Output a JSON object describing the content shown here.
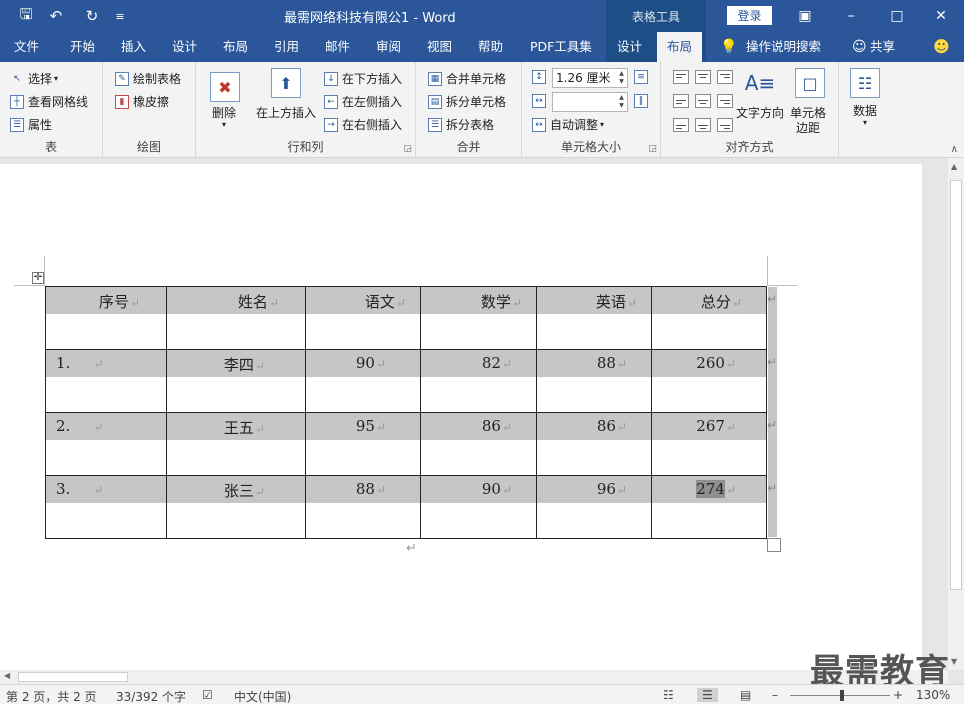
{
  "titlebar": {
    "doc_title": "最需网络科技有限公1  -  Word",
    "context_label": "表格工具",
    "login_label": "登录"
  },
  "tabs": [
    {
      "label": "文件"
    },
    {
      "label": "开始"
    },
    {
      "label": "插入"
    },
    {
      "label": "设计"
    },
    {
      "label": "布局"
    },
    {
      "label": "引用"
    },
    {
      "label": "邮件"
    },
    {
      "label": "审阅"
    },
    {
      "label": "视图"
    },
    {
      "label": "帮助"
    },
    {
      "label": "PDF工具集"
    },
    {
      "label": "设计"
    },
    {
      "label": "布局"
    }
  ],
  "search_label": "操作说明搜索",
  "share_label": "共享",
  "ribbon": {
    "table_group": {
      "label": "表",
      "select": "选择",
      "gridlines": "查看网格线",
      "properties": "属性"
    },
    "draw_group": {
      "label": "绘图",
      "draw_table": "绘制表格",
      "eraser": "橡皮擦"
    },
    "rows_group": {
      "label": "行和列",
      "delete": "删除",
      "insert_above": "在上方插入",
      "insert_below": "在下方插入",
      "insert_left": "在左侧插入",
      "insert_right": "在右侧插入"
    },
    "merge_group": {
      "label": "合并",
      "merge": "合并单元格",
      "split_cells": "拆分单元格",
      "split_table": "拆分表格"
    },
    "cellsize_group": {
      "label": "单元格大小",
      "height_value": "1.26 厘米",
      "autofit": "自动调整"
    },
    "align_group": {
      "label": "对齐方式",
      "text_direction": "文字方向",
      "cell_margins_1": "单元格",
      "cell_margins_2": "边距"
    },
    "data_group": {
      "label": "数据"
    }
  },
  "table": {
    "headers": [
      "序号",
      "姓名",
      "语文",
      "数学",
      "英语",
      "总分"
    ],
    "rows": [
      [
        "1.",
        "李四",
        "90",
        "82",
        "88",
        "260"
      ],
      [
        "2.",
        "王五",
        "95",
        "86",
        "86",
        "267"
      ],
      [
        "3.",
        "张三",
        "88",
        "90",
        "96",
        "274"
      ]
    ],
    "mark": "↵"
  },
  "watermark": "最需教育",
  "status": {
    "page": "第 2 页，共 2 页",
    "words": "33/392 个字",
    "language": "中文(中国)",
    "zoom": "130%"
  }
}
